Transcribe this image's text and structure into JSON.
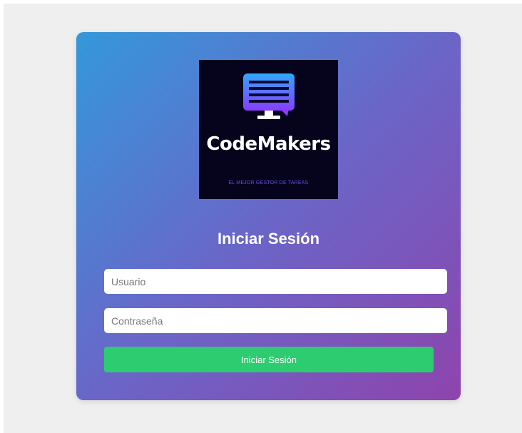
{
  "logo": {
    "wordmark": "CodeMakers",
    "tagline": "EL MEJOR GESTOR DE TAREAS",
    "icon": "chat-monitor-icon"
  },
  "login": {
    "title": "Iniciar Sesión",
    "username_placeholder": "Usuario",
    "password_placeholder": "Contraseña",
    "submit_label": "Iniciar Sesión"
  },
  "colors": {
    "page_background": "#efefef",
    "card_gradient_start": "#3498db",
    "card_gradient_end": "#8e44ad",
    "submit_button": "#2ecc71",
    "logo_background": "#05041c"
  }
}
